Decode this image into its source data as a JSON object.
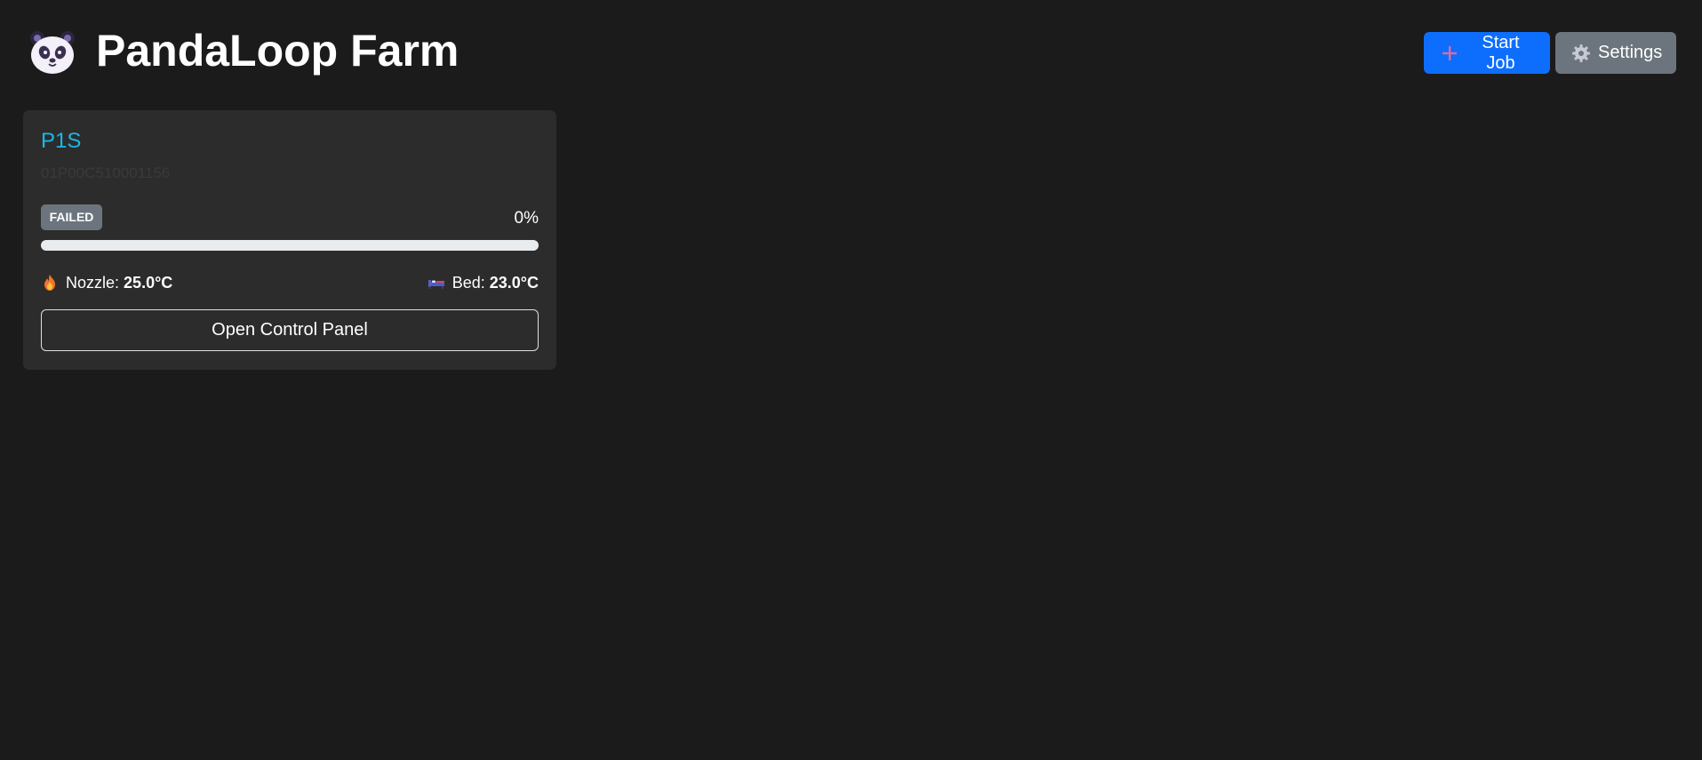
{
  "header": {
    "logo_icon": "panda-icon",
    "title": "PandaLoop Farm",
    "start_job_label": "Start Job",
    "start_job_icon": "plus-icon",
    "settings_label": "Settings",
    "settings_icon": "gear-icon"
  },
  "printers": [
    {
      "name": "P1S",
      "serial": "01P00C510001156",
      "status": "FAILED",
      "progress_text": "0%",
      "progress": 0,
      "nozzle_label": "Nozzle:",
      "nozzle_icon": "fire-icon",
      "nozzle_temp": "25.0°C",
      "bed_label": "Bed:",
      "bed_icon": "bed-icon",
      "bed_temp": "23.0°C",
      "control_button_label": "Open Control Panel"
    }
  ],
  "colors": {
    "background": "#1b1b1b",
    "card": "#2c2c2c",
    "accent_primary": "#0d6efd",
    "secondary": "#6c757d",
    "printer_name": "#1ab8e6"
  }
}
